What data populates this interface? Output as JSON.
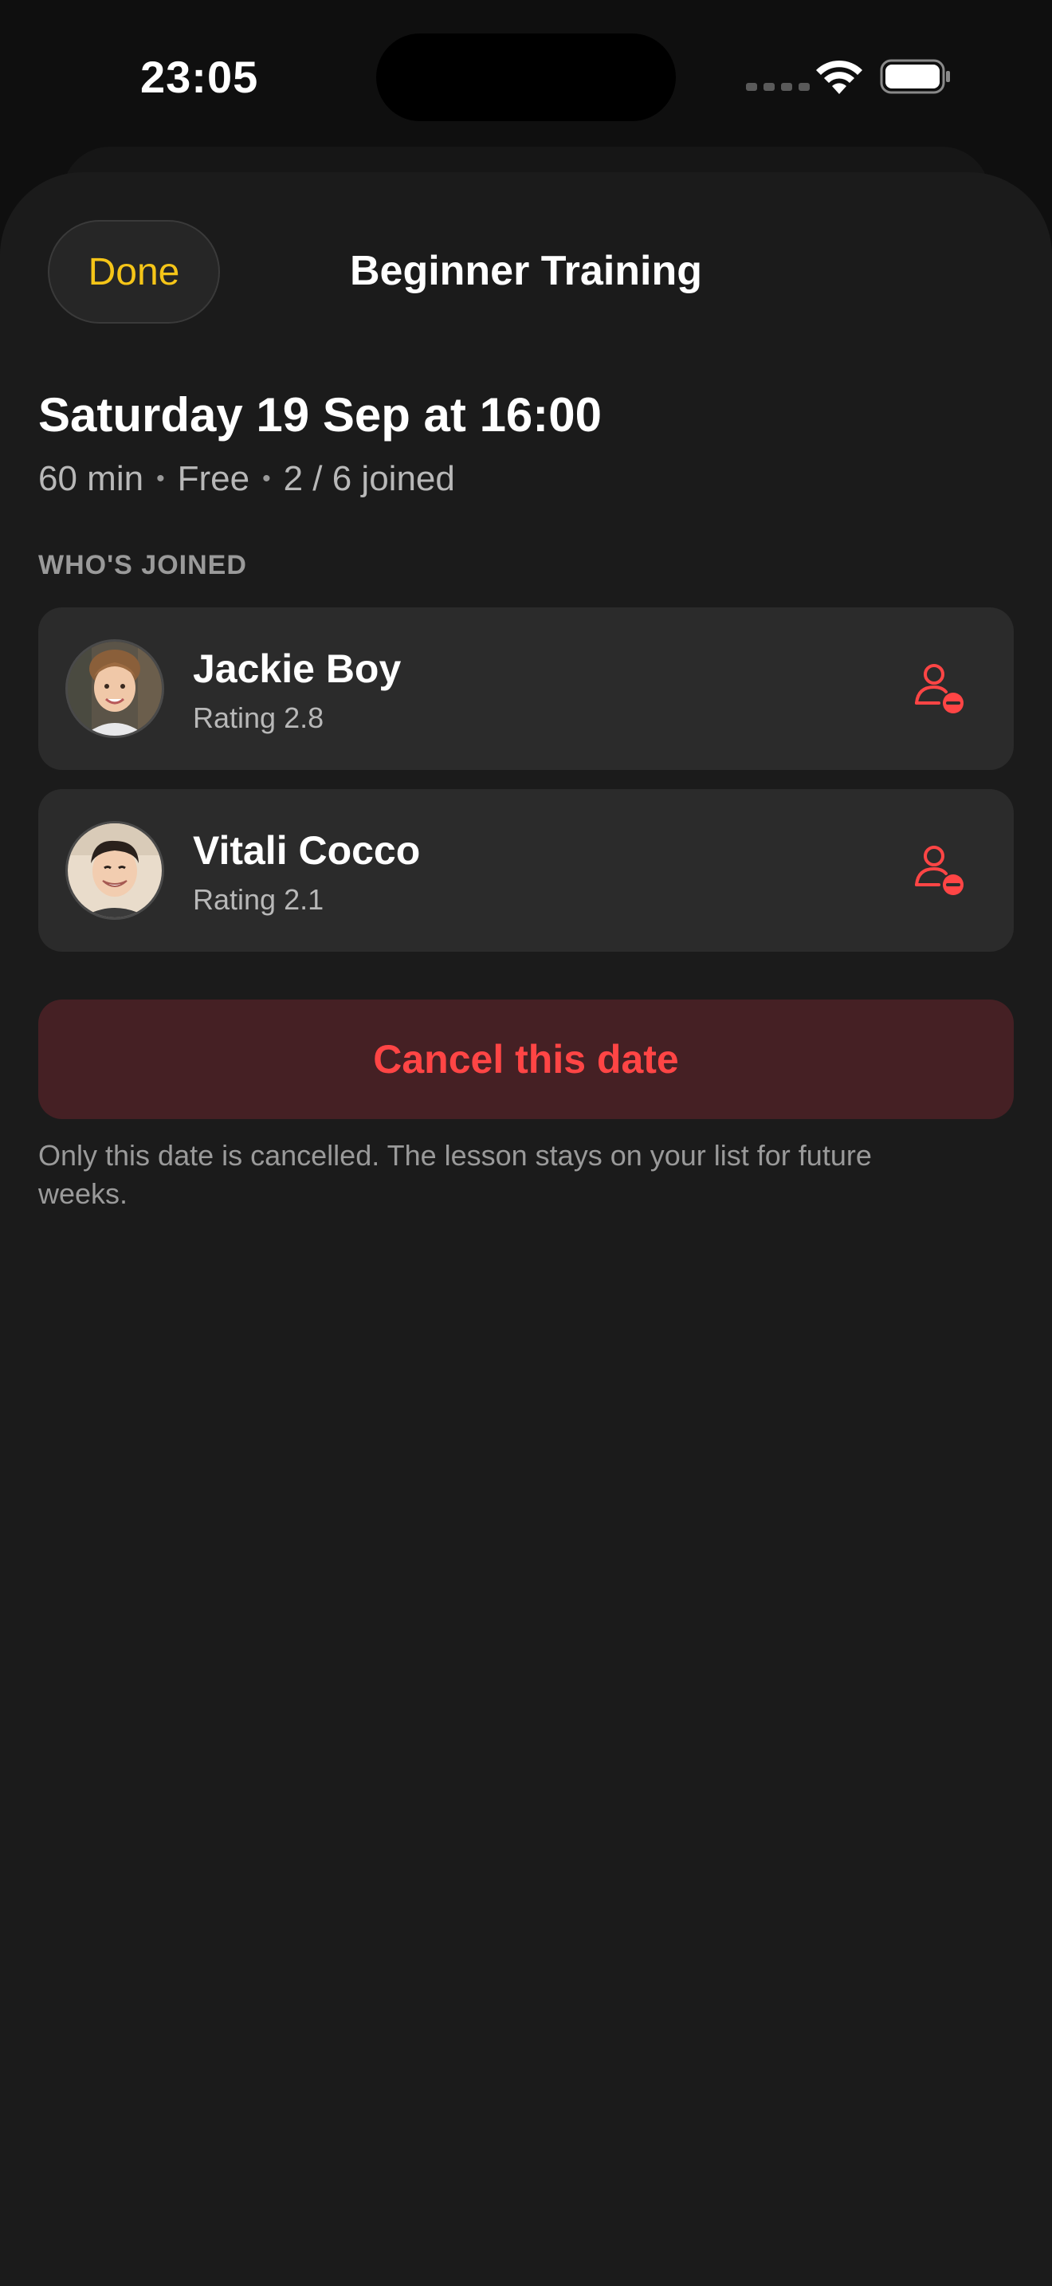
{
  "status_bar": {
    "time": "23:05"
  },
  "header": {
    "done_label": "Done",
    "title": "Beginner Training"
  },
  "session": {
    "date_heading": "Saturday 19 Sep at 16:00",
    "duration": "60 min",
    "price": "Free",
    "joined": "2 / 6 joined",
    "separator": "•"
  },
  "participants": {
    "section_label": "WHO'S JOINED",
    "items": [
      {
        "name": "Jackie Boy",
        "rating": "Rating 2.8",
        "remove_icon": "remove-user-icon"
      },
      {
        "name": "Vitali Cocco",
        "rating": "Rating 2.1",
        "remove_icon": "remove-user-icon"
      }
    ]
  },
  "actions": {
    "cancel_label": "Cancel this date",
    "cancel_note": "Only this date is cancelled. The lesson stays on your list for future weeks."
  },
  "colors": {
    "accent_done": "#f5c518",
    "destructive": "#ff4545",
    "destructive_bg": "#452024",
    "card_bg": "#2b2b2b",
    "sheet_bg": "#1b1b1b"
  }
}
